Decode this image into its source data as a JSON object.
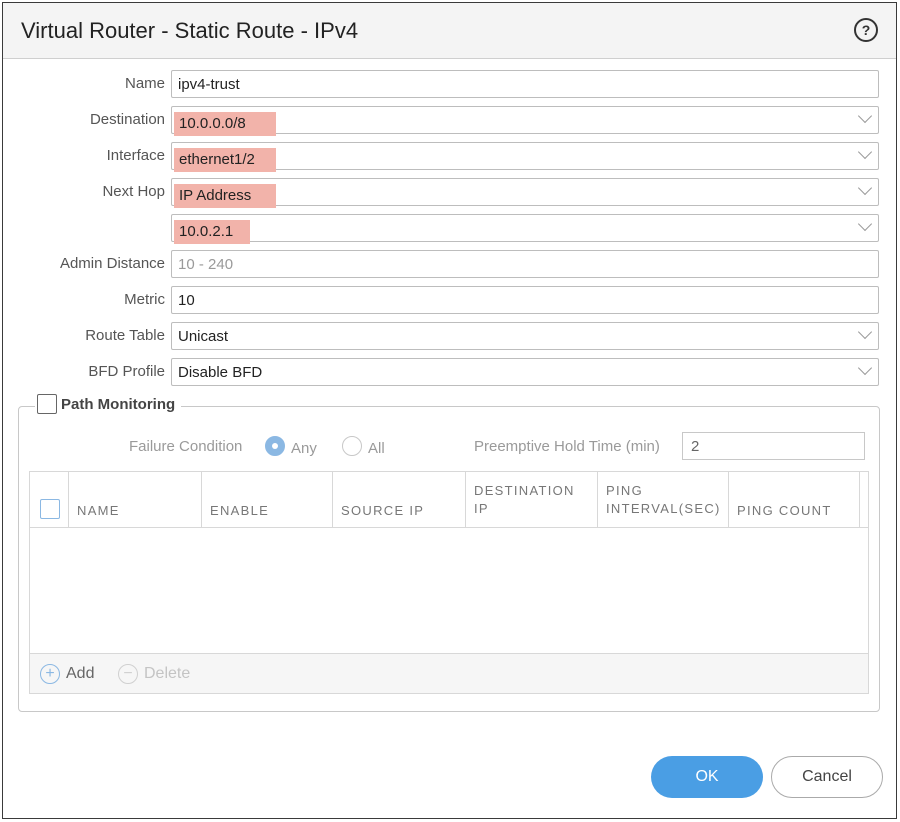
{
  "dialog": {
    "title": "Virtual Router - Static Route - IPv4",
    "help_icon": "question-circle-icon"
  },
  "form": {
    "name": {
      "label": "Name",
      "value": "ipv4-trust"
    },
    "destination": {
      "label": "Destination",
      "value": "10.0.0.0/8"
    },
    "interface": {
      "label": "Interface",
      "value": "ethernet1/2"
    },
    "next_hop": {
      "label": "Next Hop",
      "value": "IP Address"
    },
    "next_hop_ip": {
      "value": "10.0.2.1"
    },
    "admin_distance": {
      "label": "Admin Distance",
      "placeholder": "10 - 240"
    },
    "metric": {
      "label": "Metric",
      "value": "10"
    },
    "route_table": {
      "label": "Route Table",
      "value": "Unicast"
    },
    "bfd_profile": {
      "label": "BFD Profile",
      "value": "Disable BFD"
    }
  },
  "path_monitoring": {
    "label": "Path Monitoring",
    "checked": false,
    "failure_condition_label": "Failure Condition",
    "options": [
      "Any",
      "All"
    ],
    "selected": "Any",
    "hold_time_label": "Preemptive Hold Time (min)",
    "hold_time_value": "2",
    "columns": {
      "name": "NAME",
      "enable": "ENABLE",
      "source_ip": "SOURCE IP",
      "destination_ip_1": "DESTINATION",
      "destination_ip_2": "IP",
      "ping_interval_1": "PING",
      "ping_interval_2": "INTERVAL(SEC)",
      "ping_count": "PING COUNT"
    },
    "add_label": "Add",
    "delete_label": "Delete"
  },
  "buttons": {
    "ok": "OK",
    "cancel": "Cancel"
  },
  "colors": {
    "accent": "#4a9ee4",
    "highlight": "#f2b3aa"
  }
}
